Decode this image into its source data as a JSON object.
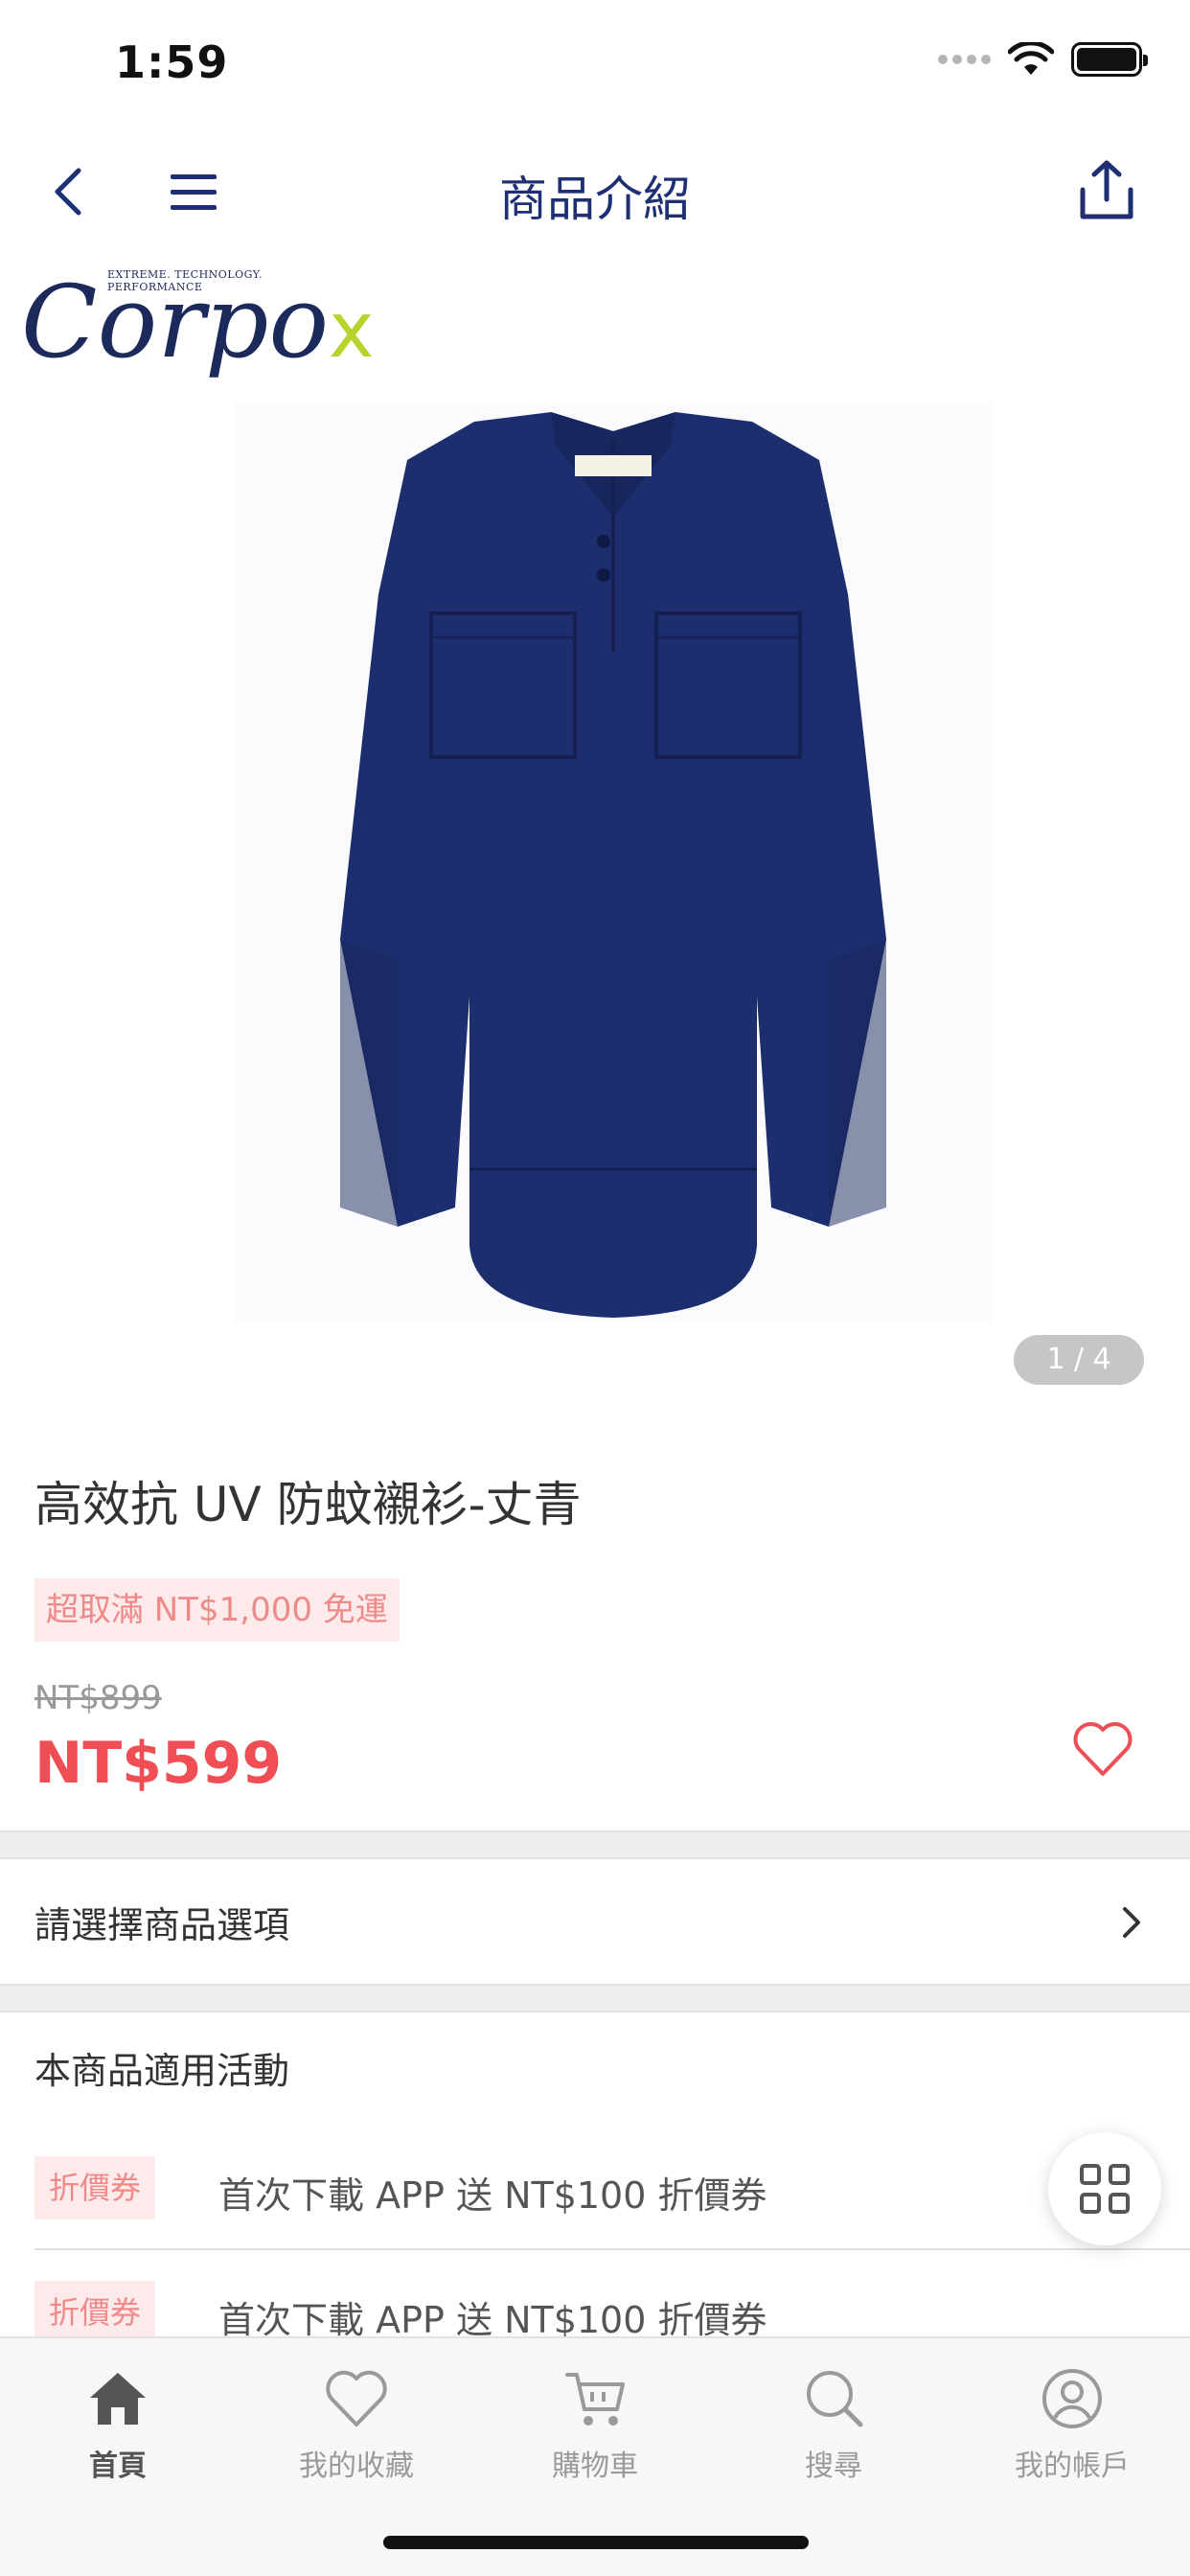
{
  "status_bar": {
    "time": "1:59"
  },
  "nav": {
    "title": "商品介紹"
  },
  "brand": {
    "name": "Corpo",
    "name_x": "x",
    "tagline": "EXTREME. TECHNOLOGY. PERFORMANCE"
  },
  "product": {
    "image_counter": "1 / 4",
    "title": "高效抗 UV 防蚊襯衫-丈青",
    "shipping_badge": "超取滿 NT$1,000 免運",
    "original_price": "NT$899",
    "sale_price": "NT$599",
    "shirt_color": "#1d2e6e"
  },
  "options": {
    "label": "請選擇商品選項"
  },
  "activities": {
    "title": "本商品適用活動",
    "items": [
      {
        "tag": "折價券",
        "text": "首次下載 APP 送 NT$100 折價券"
      },
      {
        "tag": "折價券",
        "text": "首次下載 APP 送 NT$100 折價券"
      }
    ]
  },
  "tab_bar": {
    "items": [
      {
        "label": "首頁",
        "icon": "home-icon",
        "active": true
      },
      {
        "label": "我的收藏",
        "icon": "heart-icon",
        "active": false
      },
      {
        "label": "購物車",
        "icon": "cart-icon",
        "active": false
      },
      {
        "label": "搜尋",
        "icon": "search-icon",
        "active": false
      },
      {
        "label": "我的帳戶",
        "icon": "account-icon",
        "active": false
      }
    ]
  },
  "colors": {
    "accent_navy": "#1f2f73",
    "price_red": "#ef4e55",
    "badge_pink": "#fdeaea"
  }
}
